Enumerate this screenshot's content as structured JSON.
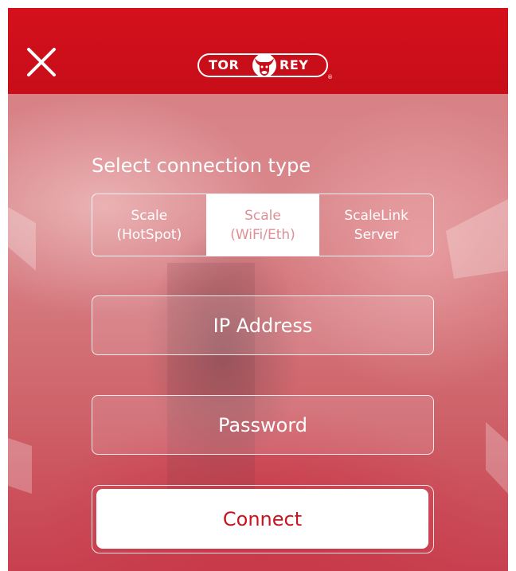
{
  "header": {
    "close_icon": "close-icon",
    "logo": {
      "left_text": "TOR",
      "right_text": "REY",
      "registered_mark": "®"
    }
  },
  "connection": {
    "title": "Select connection type",
    "options": [
      {
        "line1": "Scale",
        "line2": "(HotSpot)",
        "selected": false
      },
      {
        "line1": "Scale",
        "line2": "(WiFi/Eth)",
        "selected": true
      },
      {
        "line1": "ScaleLink",
        "line2": "Server",
        "selected": false
      }
    ]
  },
  "form": {
    "ip_placeholder": "IP Address",
    "password_placeholder": "Password",
    "connect_label": "Connect"
  },
  "colors": {
    "brand_red": "#c70e19",
    "selected_segment_text": "#df8f96",
    "connect_text": "#c8141e"
  }
}
